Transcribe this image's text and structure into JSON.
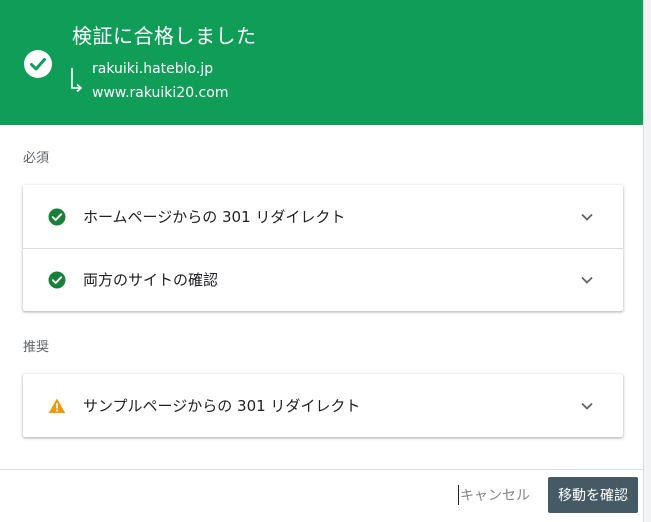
{
  "header": {
    "title": "検証に合格しました",
    "from_url": "rakuiki.hateblo.jp",
    "to_url": "www.rakuiki20.com",
    "bg_color": "#0f9d58"
  },
  "required": {
    "label": "必須",
    "items": [
      {
        "label": "ホームページからの 301 リダイレクト",
        "status": "success",
        "icon": "check-circle-icon"
      },
      {
        "label": "両方のサイトの確認",
        "status": "success",
        "icon": "check-circle-icon"
      }
    ]
  },
  "recommended": {
    "label": "推奨",
    "items": [
      {
        "label": "サンプルページからの 301 リダイレクト",
        "status": "warning",
        "icon": "warning-icon"
      }
    ]
  },
  "footer": {
    "cancel_label": "キャンセル",
    "confirm_label": "移動を確認"
  },
  "colors": {
    "success": "#188038",
    "warning": "#f29900",
    "confirm_button": "#455a64"
  }
}
